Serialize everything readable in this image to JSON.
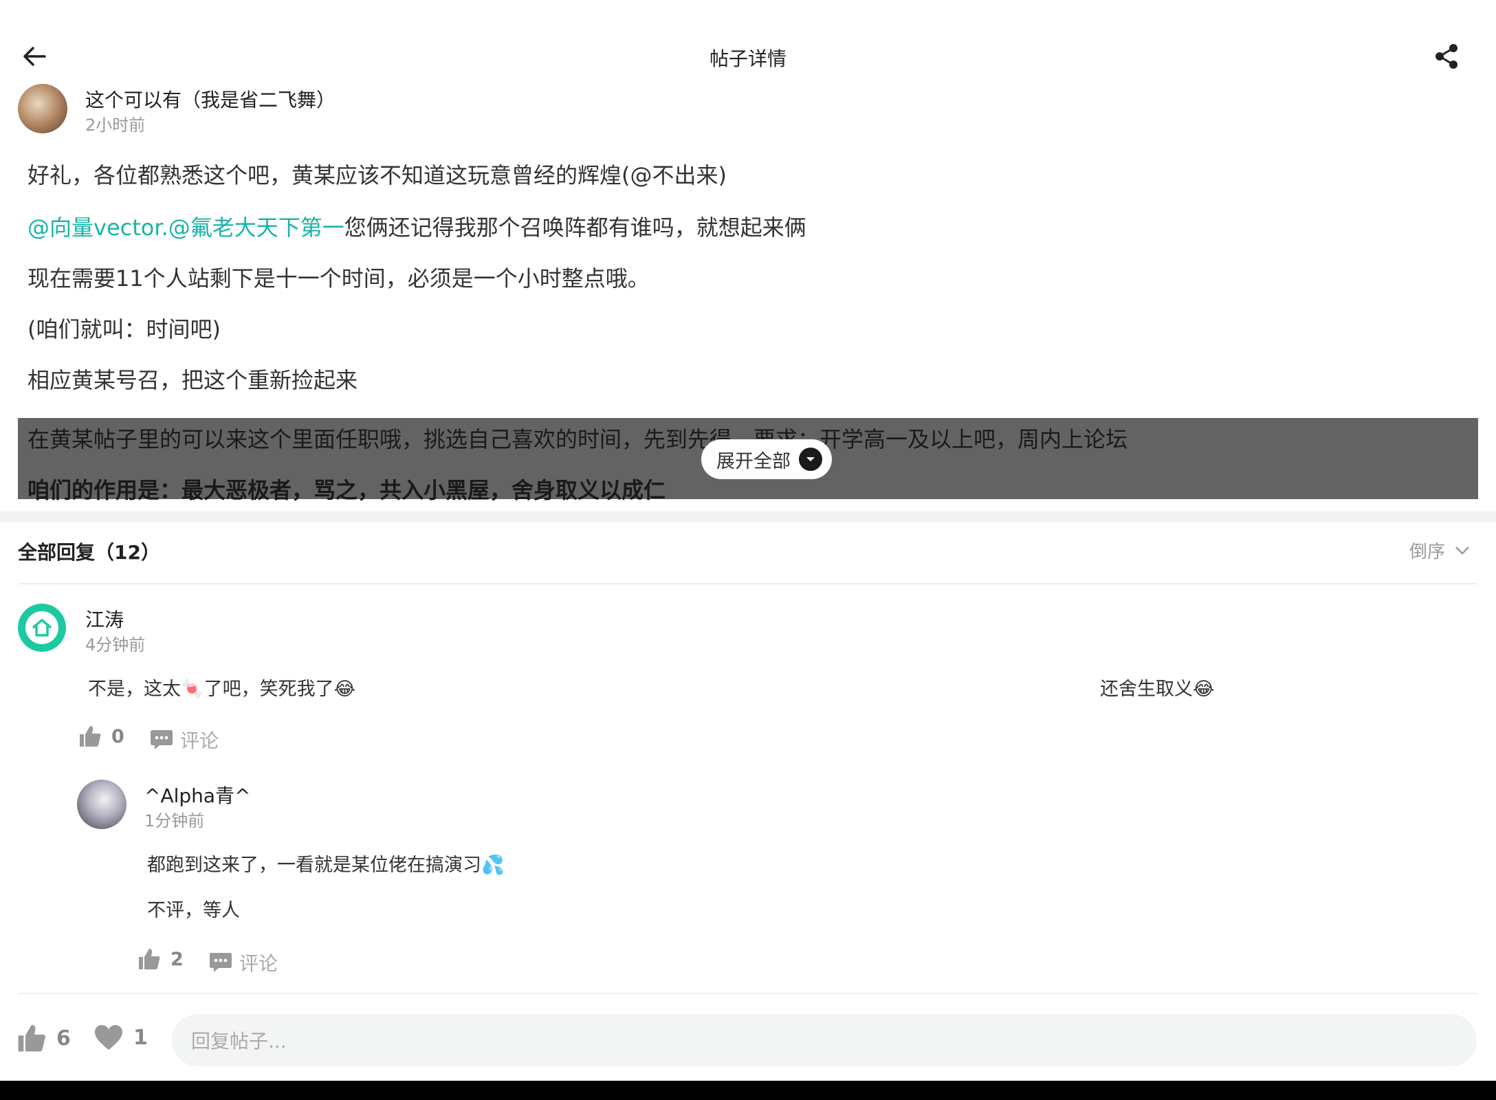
{
  "header": {
    "title": "帖子详情"
  },
  "post": {
    "author_name": "这个可以有（我是省二飞舞）",
    "time": "2小时前",
    "paragraphs": {
      "p1": "好礼，各位都熟悉这个吧，黄某应该不知道这玩意曾经的辉煌(@不出来)",
      "p2_mention": "@向量vector.@氟老大天下第一",
      "p2_rest": "您俩还记得我那个召唤阵都有谁吗，就想起来俩",
      "p3": "现在需要11个人站剩下是十一个时间，必须是一个小时整点哦。",
      "p4": "(咱们就叫：时间吧)",
      "p5": "相应黄某号召，把这个重新捡起来",
      "p6": "在黄某帖子里的可以来这个里面任职哦，挑选自己喜欢的时间，先到先得，要求：开学高一及以上吧，周内上论坛",
      "p7": "咱们的作用是：最大恶极者，骂之，共入小黑屋，舍身取义以成仁"
    },
    "expand_label": "展开全部"
  },
  "replies": {
    "title": "全部回复（12）",
    "sort_label": "倒序"
  },
  "comments": [
    {
      "name": "江涛",
      "time": "4分钟前",
      "text_left": "不是，这太🍬了吧，笑死我了😂",
      "text_right": "还舍生取义😂",
      "likes": "0",
      "comment_label": "评论"
    },
    {
      "name": "^Alpha青^",
      "time": "1分钟前",
      "text_line1": "都跑到这来了，一看就是某位佬在搞演习💦",
      "text_line2": "不评，等人",
      "likes": "2",
      "comment_label": "评论"
    }
  ],
  "bottom": {
    "likes": "6",
    "favorites": "1",
    "reply_placeholder": "回复帖子..."
  },
  "colors": {
    "mention": "#1ab3a8",
    "avatar_accent": "#1cc9a2",
    "fold_overlay": "#636363"
  }
}
